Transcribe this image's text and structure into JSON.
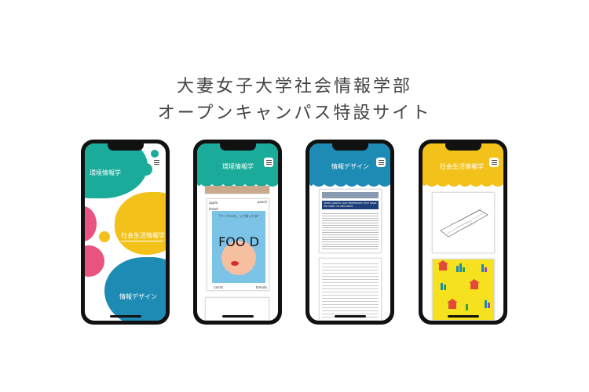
{
  "heading": {
    "line1": "大妻女子大学社会情報学部",
    "line2": "オープンキャンパス特設サイト"
  },
  "phones": {
    "home": {
      "label1": "環境情報学",
      "label2": "社会生活情報学",
      "label3": "情報デザイン"
    },
    "env": {
      "header": "環境情報学",
      "food_question": "「フードロス」って知ってる？",
      "food_title": "FOO D",
      "word_apple": "apple",
      "word_peach": "peach",
      "word_bread": "bread",
      "word_carrot": "carrot",
      "word_tomato": "tomato"
    },
    "design": {
      "header": "情報デザイン",
      "doc_title": "OPEN CAMPUS 2023 SENTENCES THAT MAKE ME HAPPY TO DECORATE"
    },
    "life": {
      "header": "社会生活情報学"
    }
  },
  "colors": {
    "teal": "#1aab9b",
    "blue": "#1e8bb5",
    "yellow": "#f2c21b",
    "pink": "#e8547f",
    "peach": "#f5bfa0"
  },
  "icons": [
    "menu-icon",
    "battery-icon",
    "signal-icon"
  ]
}
